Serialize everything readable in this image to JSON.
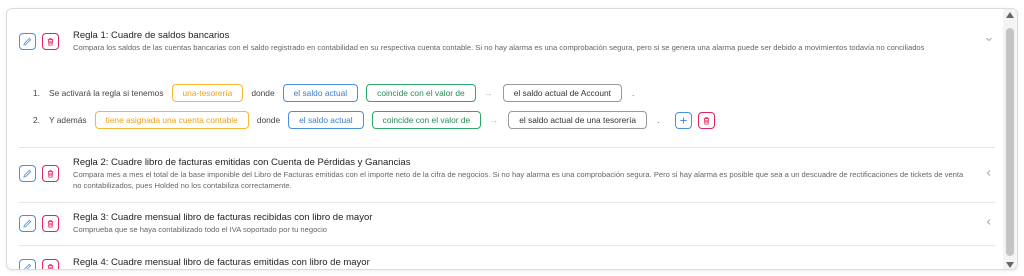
{
  "rules": [
    {
      "title": "Regla 1: Cuadre de saldos bancarios",
      "description": "Compara los saldos de las cuentas bancarias con el saldo registrado en contabilidad en su respectiva cuenta contable. Si no hay alarma es una comprobación segura, pero si se genera una alarma puede ser debido a movimientos todavía no conciliados",
      "expanded": true,
      "conditions": [
        {
          "number": "1.",
          "prefix": "Se activará la regla si tenemos",
          "subject": "una-tesorería",
          "where": "donde",
          "field": "el saldo actual",
          "operator": "coincide con el valor de",
          "target": "el saldo actual de Account",
          "end": "."
        },
        {
          "number": "2.",
          "prefix": "Y además",
          "subject": "tiene asignada una cuenta contable",
          "where": "donde",
          "field": "el saldo actual",
          "operator": "coincide con el valor de",
          "target": "el saldo actual de una tesorería",
          "end": "."
        }
      ]
    },
    {
      "title": "Regla 2: Cuadre libro de facturas emitidas con Cuenta de Pérdidas y Ganancias",
      "description": "Compara mes a mes el total de la base imponible del Libro de Facturas emitidas con el importe neto de la cifra de negocios. Si no hay alarma es una comprobación segura. Pero si hay alarma es posible que sea a un descuadre de rectificaciones de tickets de venta no contabilizados, pues Holded no los contabiliza correctamente."
    },
    {
      "title": "Regla 3: Cuadre mensual libro de facturas recibidas con libro de mayor",
      "description": "Comprueba que se haya contabilizado todo el IVA soportado por tu negocio"
    },
    {
      "title": "Regla 4: Cuadre mensual libro de facturas emitidas con libro de mayor",
      "description": ""
    }
  ],
  "icons": {
    "edit": "pencil-icon",
    "delete": "trash-icon",
    "add": "plus-icon",
    "expanded": "chevron-down-icon",
    "collapsed": "chevron-left-icon",
    "arrow": "arrow-right-icon"
  },
  "colors": {
    "edit": "#4a90d9",
    "delete": "#e0245e",
    "subject": "#f5b82e",
    "field": "#4a90d9",
    "operator": "#2fa86b"
  }
}
